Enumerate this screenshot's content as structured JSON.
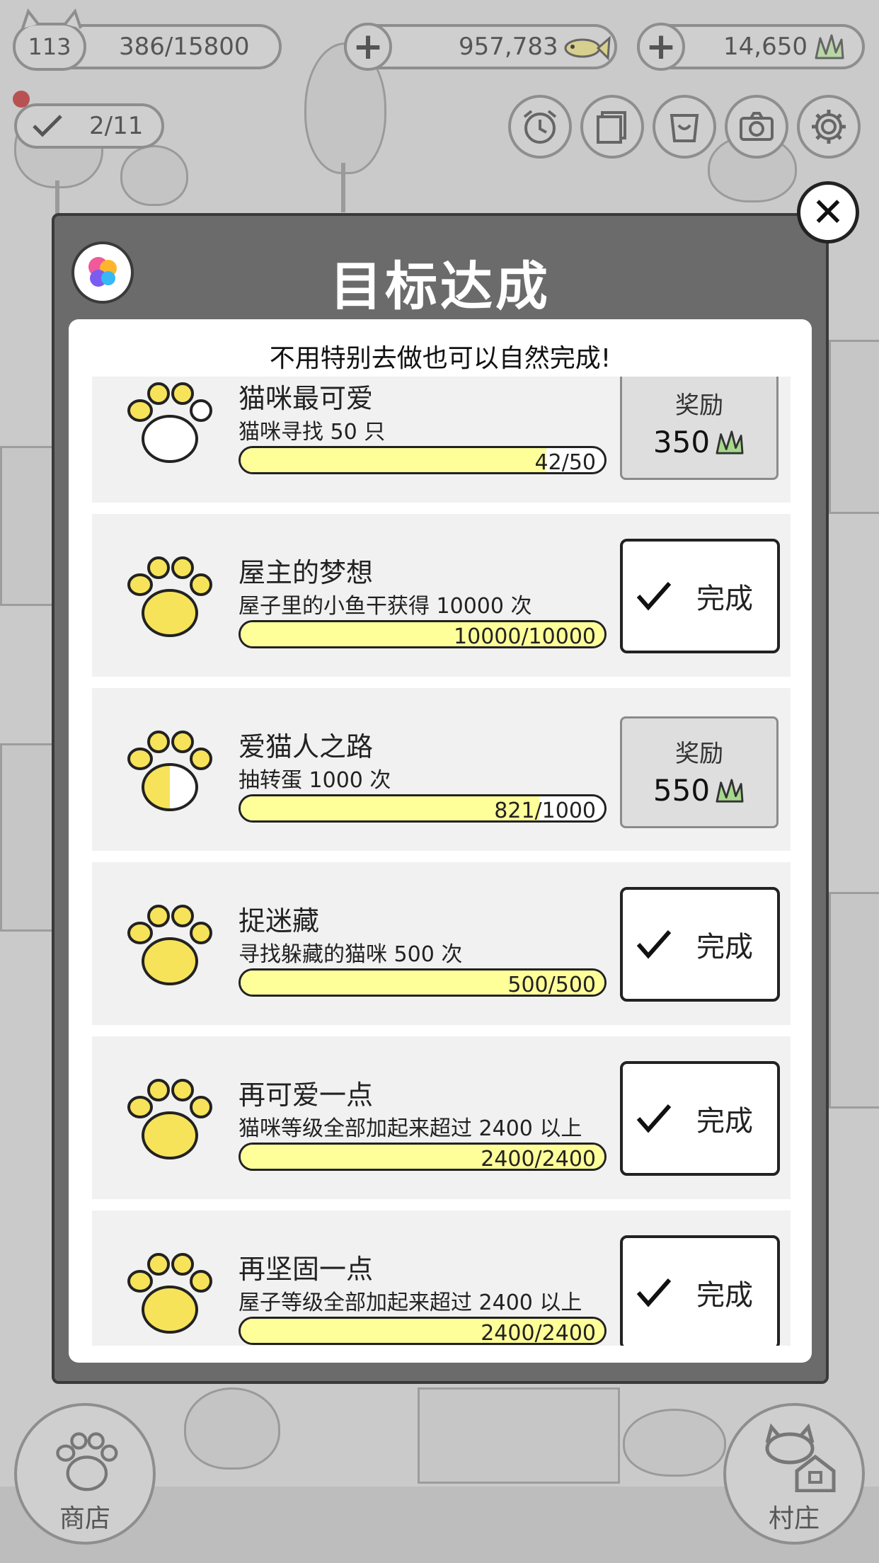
{
  "hud": {
    "level": "113",
    "cat_progress": "386/15800",
    "fish_count": "957,783",
    "grass_count": "14,650",
    "quests": "2/11"
  },
  "icons": {
    "top_buttons": [
      "alarm-clock-icon",
      "cards-icon",
      "gift-bag-icon",
      "camera-icon",
      "gear-icon"
    ]
  },
  "modal": {
    "title": "目标达成",
    "subtitle": "不用特别去做也可以自然完成!",
    "items": [
      {
        "title": "猫咪最可爱",
        "desc": "猫咪寻找 50 只",
        "progress_text": "42/50",
        "progress": 0.84,
        "status": "reward",
        "reward_label": "奖励",
        "reward_amount": "350"
      },
      {
        "title": "屋主的梦想",
        "desc": "屋子里的小鱼干获得 10000 次",
        "progress_text": "10000/10000",
        "progress": 1.0,
        "status": "done",
        "done_label": "完成"
      },
      {
        "title": "爱猫人之路",
        "desc": "抽转蛋 1000 次",
        "progress_text": "821/1000",
        "progress": 0.821,
        "status": "reward",
        "reward_label": "奖励",
        "reward_amount": "550"
      },
      {
        "title": "捉迷藏",
        "desc": "寻找躲藏的猫咪 500 次",
        "progress_text": "500/500",
        "progress": 1.0,
        "status": "done",
        "done_label": "完成"
      },
      {
        "title": "再可爱一点",
        "desc": "猫咪等级全部加起来超过 2400 以上",
        "progress_text": "2400/2400",
        "progress": 1.0,
        "status": "done",
        "done_label": "完成"
      },
      {
        "title": "再坚固一点",
        "desc": "屋子等级全部加起来超过 2400 以上",
        "progress_text": "2400/2400",
        "progress": 1.0,
        "status": "done",
        "done_label": "完成"
      }
    ]
  },
  "nav": {
    "shop_label": "商店",
    "village_label": "村庄"
  },
  "colors": {
    "paw_yellow": "#f7e35a",
    "bar_yellow": "#ffff9a",
    "modal_frame": "#6b6b6b",
    "grass_green": "#a7d88c"
  }
}
